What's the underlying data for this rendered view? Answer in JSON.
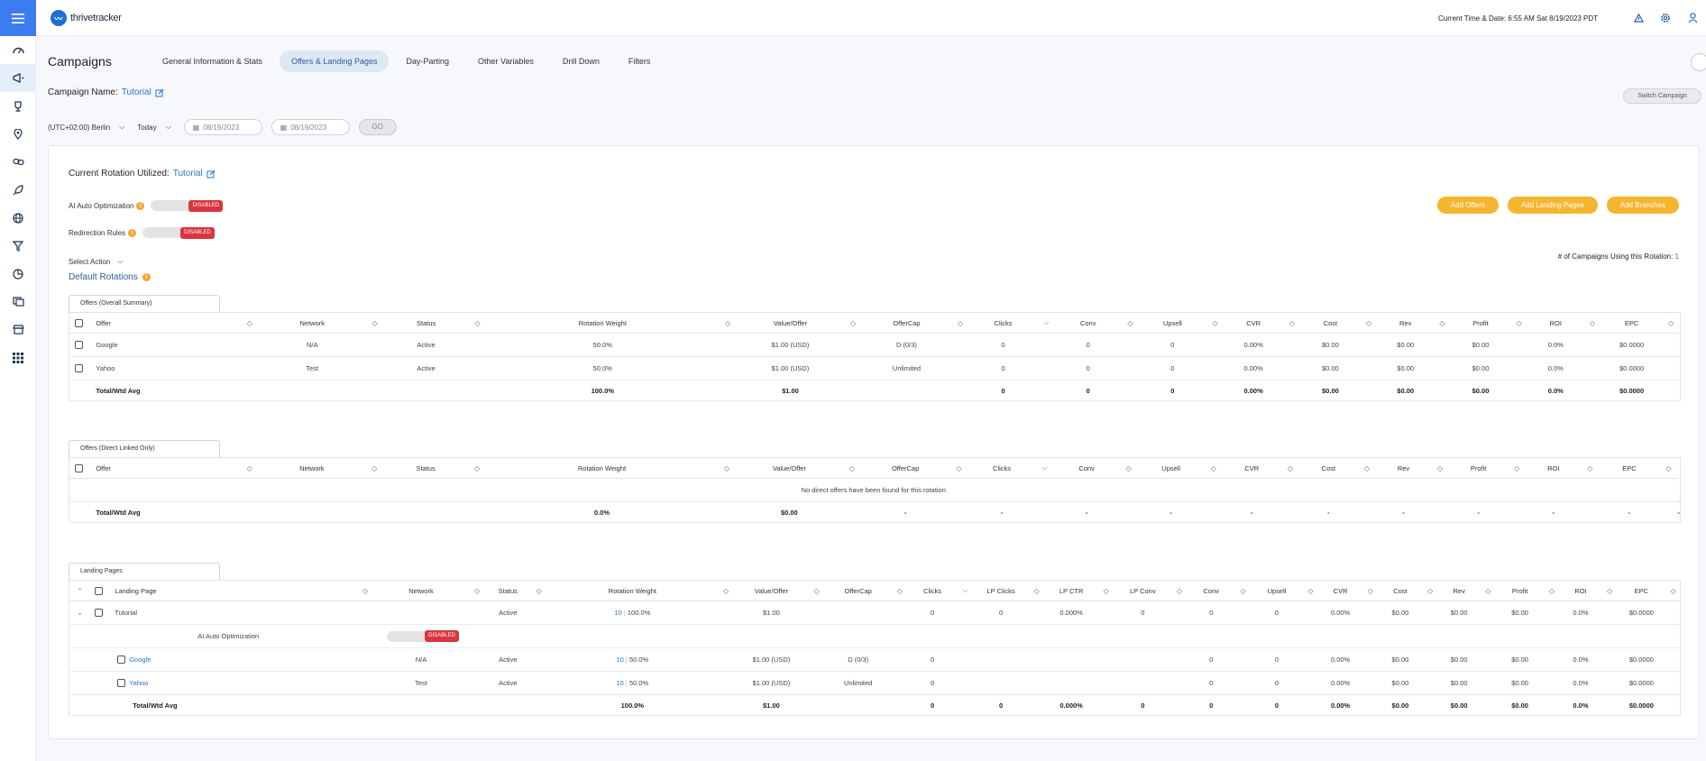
{
  "header": {
    "logo_text": "thrivetracker",
    "datetime": "Current Time & Date: 6:55 AM Sat 8/19/2023 PDT"
  },
  "sidebar": {
    "items": [
      "dashboard-icon",
      "campaigns-icon",
      "trophy-icon",
      "location-icon",
      "link-icon",
      "rocket-icon",
      "globe-icon",
      "funnel-icon",
      "pie-icon",
      "reports-icon",
      "store-icon",
      "apps-icon"
    ]
  },
  "page": {
    "title": "Campaigns",
    "tabs": [
      "General Information & Stats",
      "Offers & Landing Pages",
      "Day-Parting",
      "Other Variables",
      "Drill Down",
      "Filters"
    ],
    "active_tab": 1
  },
  "campaign": {
    "label": "Campaign Name:",
    "name": "Tutorial"
  },
  "switch_campaign": "Switch Campaign",
  "filters": {
    "timezone": "(UTC+02:00) Berlin",
    "range": "Today",
    "date_from": "08/19/2023",
    "date_to": "08/19/2023",
    "go": "GO"
  },
  "rotation": {
    "label": "Current Rotation Utilized:",
    "name": "Tutorial",
    "ai_label": "AI Auto Optimization",
    "ai_state": "DISABLED",
    "redir_label": "Redirection Rules",
    "redir_state": "DISABLED",
    "select_action": "Select Action",
    "default_rotations": "Default Rotations",
    "buttons": [
      "Add Offers",
      "Add Landing Pages",
      "Add Branches"
    ],
    "campaigns_using_label": "# of Campaigns Using this Rotation:",
    "campaigns_using_value": "1"
  },
  "offers_summary": {
    "tab": "Offers (Overall Summary)",
    "headers": [
      "Offer",
      "Network",
      "Status",
      "Rotation Weight",
      "Value/Offer",
      "OfferCap",
      "Clicks",
      "Conv",
      "Upsell",
      "CVR",
      "Cost",
      "Rev",
      "Profit",
      "ROI",
      "EPC"
    ],
    "rows": [
      {
        "offer": "Google",
        "network": "N/A",
        "status": "Active",
        "weight": "50.0%",
        "value": "$1.00 (USD)",
        "cap": "D (0/3)",
        "clicks": "0",
        "conv": "0",
        "upsell": "0",
        "cvr": "0.00%",
        "cost": "$0.00",
        "rev": "$0.00",
        "profit": "$0.00",
        "roi": "0.0%",
        "epc": "$0.0000"
      },
      {
        "offer": "Yahoo",
        "network": "Test",
        "status": "Active",
        "weight": "50.0%",
        "value": "$1.00 (USD)",
        "cap": "Unlimited",
        "clicks": "0",
        "conv": "0",
        "upsell": "0",
        "cvr": "0.00%",
        "cost": "$0.00",
        "rev": "$0.00",
        "profit": "$0.00",
        "roi": "0.0%",
        "epc": "$0.0000"
      }
    ],
    "total": {
      "label": "Total/Wtd Avg",
      "weight": "100.0%",
      "value": "$1.00",
      "clicks": "0",
      "conv": "0",
      "upsell": "0",
      "cvr": "0.00%",
      "cost": "$0.00",
      "rev": "$0.00",
      "profit": "$0.00",
      "roi": "0.0%",
      "epc": "$0.0000"
    }
  },
  "offers_direct": {
    "tab": "Offers (Direct Linked Only)",
    "headers": [
      "Offer",
      "Network",
      "Status",
      "Rotation Weight",
      "Value/Offer",
      "OfferCap",
      "Clicks",
      "Conv",
      "Upsell",
      "CVR",
      "Cost",
      "Rev",
      "Profit",
      "ROI",
      "EPC"
    ],
    "empty": "No direct offers have been found for this rotation",
    "total": {
      "label": "Total/Wtd Avg",
      "weight": "0.0%",
      "value": "$0.00",
      "dash": "-"
    }
  },
  "landing_pages": {
    "tab": "Landing Pages",
    "headers": [
      "Landing Page",
      "Network",
      "Status",
      "Rotation Weight",
      "Value/Offer",
      "OfferCap",
      "Clicks",
      "LP Clicks",
      "LP CTR",
      "LP Conv",
      "Conv",
      "Upsell",
      "CVR",
      "Cost",
      "Rev",
      "Profit",
      "ROI",
      "EPC"
    ],
    "lp": {
      "name": "Tutorial",
      "status": "Active",
      "weight_num": "10",
      "weight": "100.0%",
      "value": "$1.00",
      "clicks": "0",
      "lpclicks": "0",
      "lpctr": "0.000%",
      "lpconv": "0",
      "conv": "0",
      "upsell": "0",
      "cvr": "0.00%",
      "cost": "$0.00",
      "rev": "$0.00",
      "profit": "$0.00",
      "roi": "0.0%",
      "epc": "$0.0000"
    },
    "ai_label": "AI Auto Optimization",
    "ai_state": "DISABLED",
    "sub": [
      {
        "offer": "Google",
        "network": "N/A",
        "status": "Active",
        "weight_num": "10",
        "weight": "50.0%",
        "value": "$1.00 (USD)",
        "cap": "D (0/3)",
        "clicks": "0",
        "conv": "0",
        "upsell": "0",
        "cvr": "0.00%",
        "cost": "$0.00",
        "rev": "$0.00",
        "profit": "$0.00",
        "roi": "0.0%",
        "epc": "$0.0000"
      },
      {
        "offer": "Yahoo",
        "network": "Test",
        "status": "Active",
        "weight_num": "10",
        "weight": "50.0%",
        "value": "$1.00 (USD)",
        "cap": "Unlimited",
        "clicks": "0",
        "conv": "0",
        "upsell": "0",
        "cvr": "0.00%",
        "cost": "$0.00",
        "rev": "$0.00",
        "profit": "$0.00",
        "roi": "0.0%",
        "epc": "$0.0000"
      }
    ],
    "total": {
      "label": "Total/Wtd Avg",
      "weight": "100.0%",
      "value": "$1.00",
      "clicks": "0",
      "lpclicks": "0",
      "lpctr": "0.000%",
      "lpconv": "0",
      "conv": "0",
      "upsell": "0",
      "cvr": "0.00%",
      "cost": "$0.00",
      "rev": "$0.00",
      "profit": "$0.00",
      "roi": "0.0%",
      "epc": "$0.0000"
    }
  },
  "colors": {
    "accent": "#3d7bf0",
    "orange": "#f5b62f",
    "disabled": "#d9353e",
    "active": "#2ea44f"
  }
}
